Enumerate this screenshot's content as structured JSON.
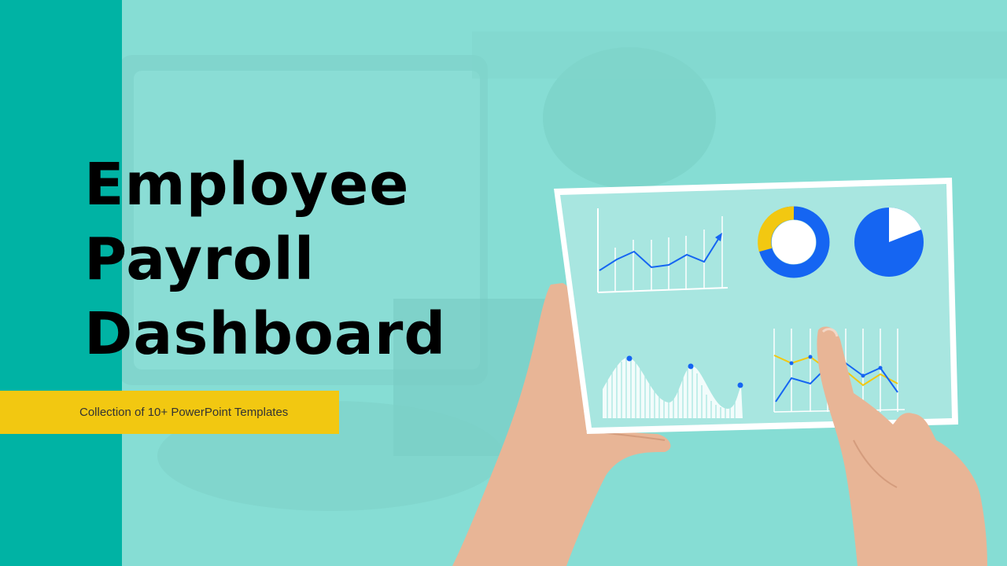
{
  "slide": {
    "title_lines": [
      "Employee",
      "Payroll",
      "Dashboard"
    ],
    "subtitle": "Collection of 10+ PowerPoint Templates"
  },
  "colors": {
    "background": "#86ddd4",
    "left_band": "#00b3a4",
    "accent_bar": "#f2c811",
    "chart_blue": "#1565f2",
    "chart_yellow": "#f2c811"
  },
  "icons": {
    "tablet": "tablet-with-charts-illustration",
    "hands": "hands-holding-tablet-illustration"
  }
}
